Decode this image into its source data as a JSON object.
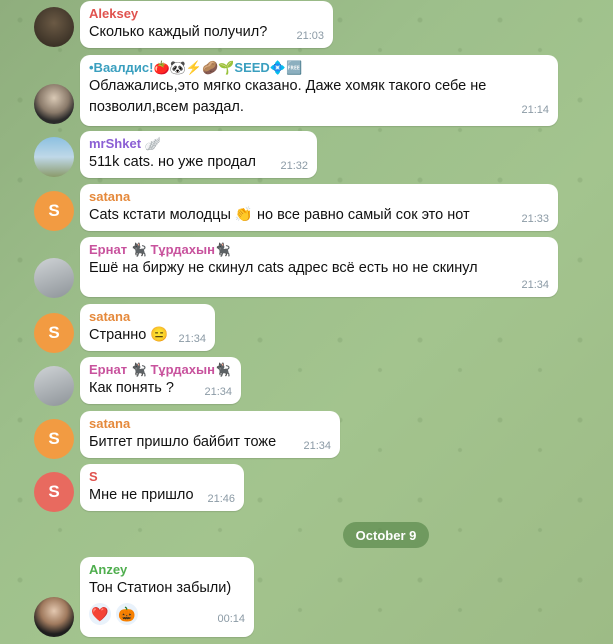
{
  "colors": {
    "accent": "#4fae4e",
    "bg": "#9dbf8b"
  },
  "messages": [
    {
      "sender": "Aleksey",
      "sender_color": "#e0534f",
      "text": "Сколько каждый получил?",
      "time": "21:03",
      "avatar": "photo-dark"
    },
    {
      "sender": "•Ваалдис!🍅🐼⚡🥔🌱SEED💠🆓",
      "sender_color": "#3a9fbf",
      "text": "Облажались,это мягко сказано. Даже хомяк такого себе не позволил,всем раздал.",
      "time": "21:14",
      "avatar": "photo-man-cap"
    },
    {
      "sender": "mrShket 🪽",
      "sender_color": "#8b5fd4",
      "text": "511k cats. но уже продал",
      "time": "21:32",
      "avatar": "photo-outdoor"
    },
    {
      "sender": "satana",
      "sender_color": "#e5893b",
      "text": "Cats кстати молодцы 👏 но все равно самый сок это нот",
      "time": "21:33",
      "avatar": "S",
      "avatar_color": "#f29b42"
    },
    {
      "sender": "Ернат 🐈‍⬛ Тұрдахын🐈‍⬛",
      "sender_color": "#c8529d",
      "text": "Ешё на биржу не скинул cats адрес всё есть но не скинул",
      "time": "21:34",
      "avatar": "photo-grey"
    },
    {
      "sender": "satana",
      "sender_color": "#e5893b",
      "text": "Странно 😑",
      "time": "21:34",
      "avatar": "S",
      "avatar_color": "#f29b42"
    },
    {
      "sender": "Ернат 🐈‍⬛ Тұрдахын🐈‍⬛",
      "sender_color": "#c8529d",
      "text": "Как понять ?",
      "time": "21:34",
      "avatar": "photo-grey"
    },
    {
      "sender": "satana",
      "sender_color": "#e5893b",
      "text": "Битгет пришло байбит тоже",
      "time": "21:34",
      "avatar": "S",
      "avatar_color": "#f29b42"
    },
    {
      "sender": "S",
      "sender_color": "#e0534f",
      "text": "Мне не пришло",
      "time": "21:46",
      "avatar": "S",
      "avatar_color": "#e86a5f"
    },
    {
      "sender": "Anzey",
      "sender_color": "#4fae4e",
      "text": "Тон Статион забыли)",
      "time": "00:14",
      "avatar": "photo-suit",
      "reactions": [
        "❤️",
        "🎃"
      ]
    }
  ],
  "date_separator": "October 9"
}
